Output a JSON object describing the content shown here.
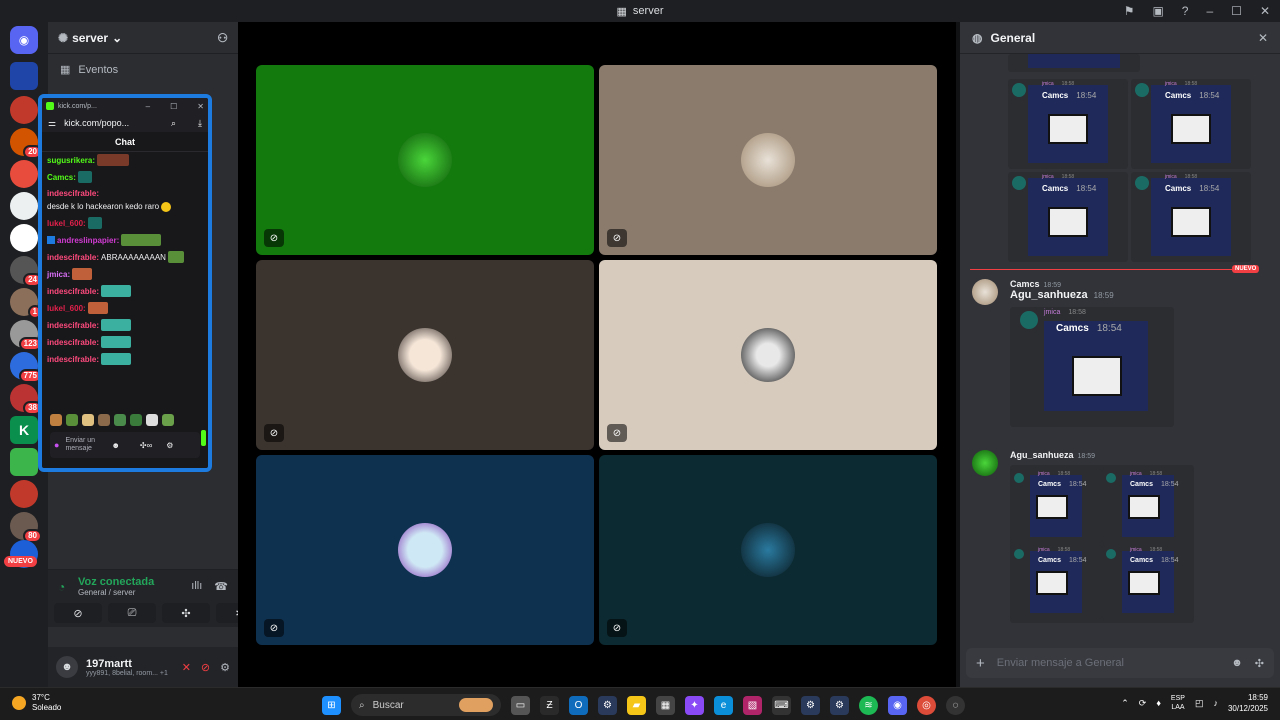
{
  "window": {
    "title": "server"
  },
  "server": {
    "name": "server",
    "events_label": "Eventos"
  },
  "rail": {
    "badges": [
      "20",
      "24",
      "1",
      "123",
      "775",
      "38",
      "80"
    ],
    "new_label": "NUEVO"
  },
  "voice": {
    "status": "Voz conectada",
    "channel": "General / server"
  },
  "user": {
    "name": "197martt",
    "status": "yyy891, 8belial, room... +1"
  },
  "popup": {
    "tab_title": "kick.com/p...",
    "address": "kick.com/popo...",
    "chat_header": "Chat",
    "messages": [
      {
        "user": "sugusrikera:",
        "text": "",
        "color": "#53fc18"
      },
      {
        "user": "Camcs:",
        "text": "",
        "color": "#53fc18"
      },
      {
        "user": "indescifrable:",
        "text": "desde k lo hackearon kedo raro",
        "color": "#ff4a7d"
      },
      {
        "user": "lukel_600:",
        "text": "",
        "color": "#e0204a"
      },
      {
        "user": "andreslinpapier:",
        "text": "",
        "color": "#d13bd1"
      },
      {
        "user": "indescifrable:",
        "text": "ABRAAAAAAAAN",
        "color": "#ff4a7d"
      },
      {
        "user": "jmica:",
        "text": "",
        "color": "#d86ef5"
      },
      {
        "user": "indescifrable:",
        "text": "",
        "color": "#ff4a7d"
      },
      {
        "user": "lukel_600:",
        "text": "",
        "color": "#e0204a"
      },
      {
        "user": "indescifrable:",
        "text": "",
        "color": "#ff4a7d"
      },
      {
        "user": "indescifrable:",
        "text": "",
        "color": "#ff4a7d"
      },
      {
        "user": "indescifrable:",
        "text": "",
        "color": "#ff4a7d"
      }
    ],
    "input_placeholder": "Enviar un mensaje"
  },
  "chat": {
    "channel": "General",
    "new_label": "NUEVO",
    "embed_user": "Camcs",
    "embed_time": "18:54",
    "embed_small_user": "jmica",
    "embed_small_time": "18:58",
    "msg1": {
      "author": "Camcs",
      "time": "18:59",
      "overlay_author": "Agu_sanhueza",
      "overlay_time": "18:59"
    },
    "msg2": {
      "author": "Agu_sanhueza",
      "time": "18:59"
    },
    "composer_placeholder": "Enviar mensaje a General"
  },
  "taskbar": {
    "temperature": "37°C",
    "weather": "Soleado",
    "search_label": "Buscar",
    "lang_top": "ESP",
    "lang_bottom": "LAA",
    "time": "18:59",
    "date": "30/12/2025"
  },
  "colors": {
    "accent_green": "#23a55a",
    "kick_green": "#53fc18",
    "popup_border": "#1d7be0",
    "new_red": "#f23f43"
  }
}
